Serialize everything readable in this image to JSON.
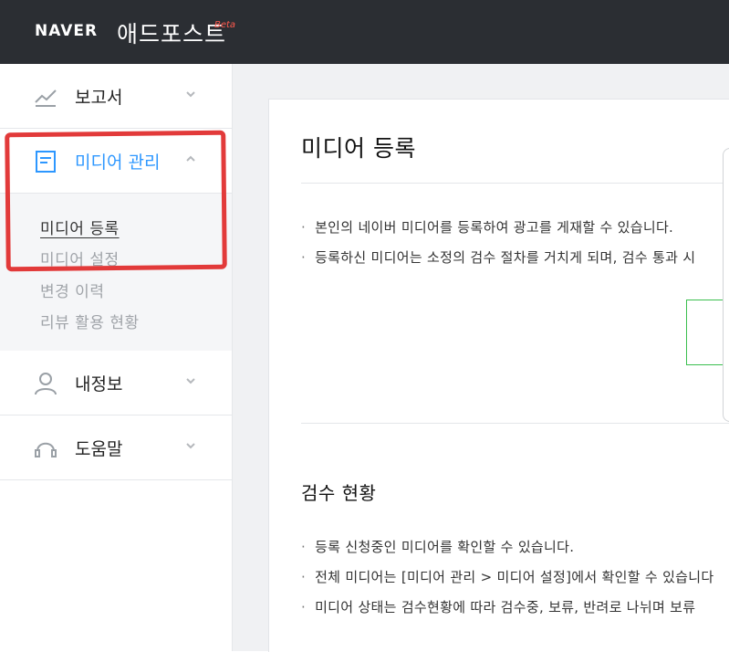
{
  "header": {
    "brand": "NAVER",
    "product": "애드포스트",
    "beta": "Beta"
  },
  "sidebar": {
    "items": [
      {
        "label": "보고서",
        "icon": "chart-line-icon"
      },
      {
        "label": "미디어 관리",
        "icon": "document-icon"
      },
      {
        "label": "내정보",
        "icon": "user-icon"
      },
      {
        "label": "도움말",
        "icon": "headset-icon"
      }
    ],
    "submenu": [
      {
        "label": "미디어 등록"
      },
      {
        "label": "미디어 설정"
      },
      {
        "label": "변경 이력"
      },
      {
        "label": "리뷰 활용 현황"
      }
    ]
  },
  "main": {
    "title": "미디어 등록",
    "bullets_top": [
      "본인의 네이버 미디어를 등록하여 광고를 게재할 수 있습니다.",
      "등록하신 미디어는 소정의 검수 절차를 거치게 되며, 검수 통과 시"
    ],
    "section_title": "검수 현황",
    "bullets_bottom": [
      "등록 신청중인 미디어를 확인할 수 있습니다.",
      "전체 미디어는 [미디어 관리 > 미디어 설정]에서 확인할 수 있습니다",
      "미디어 상태는 검수현황에 따라 검수중, 보류, 반려로 나뉘며 보류"
    ]
  },
  "colors": {
    "topbar": "#2b2e33",
    "active": "#2d97ff",
    "annotation": "#e23a3a",
    "beta": "#ff5a4e"
  }
}
